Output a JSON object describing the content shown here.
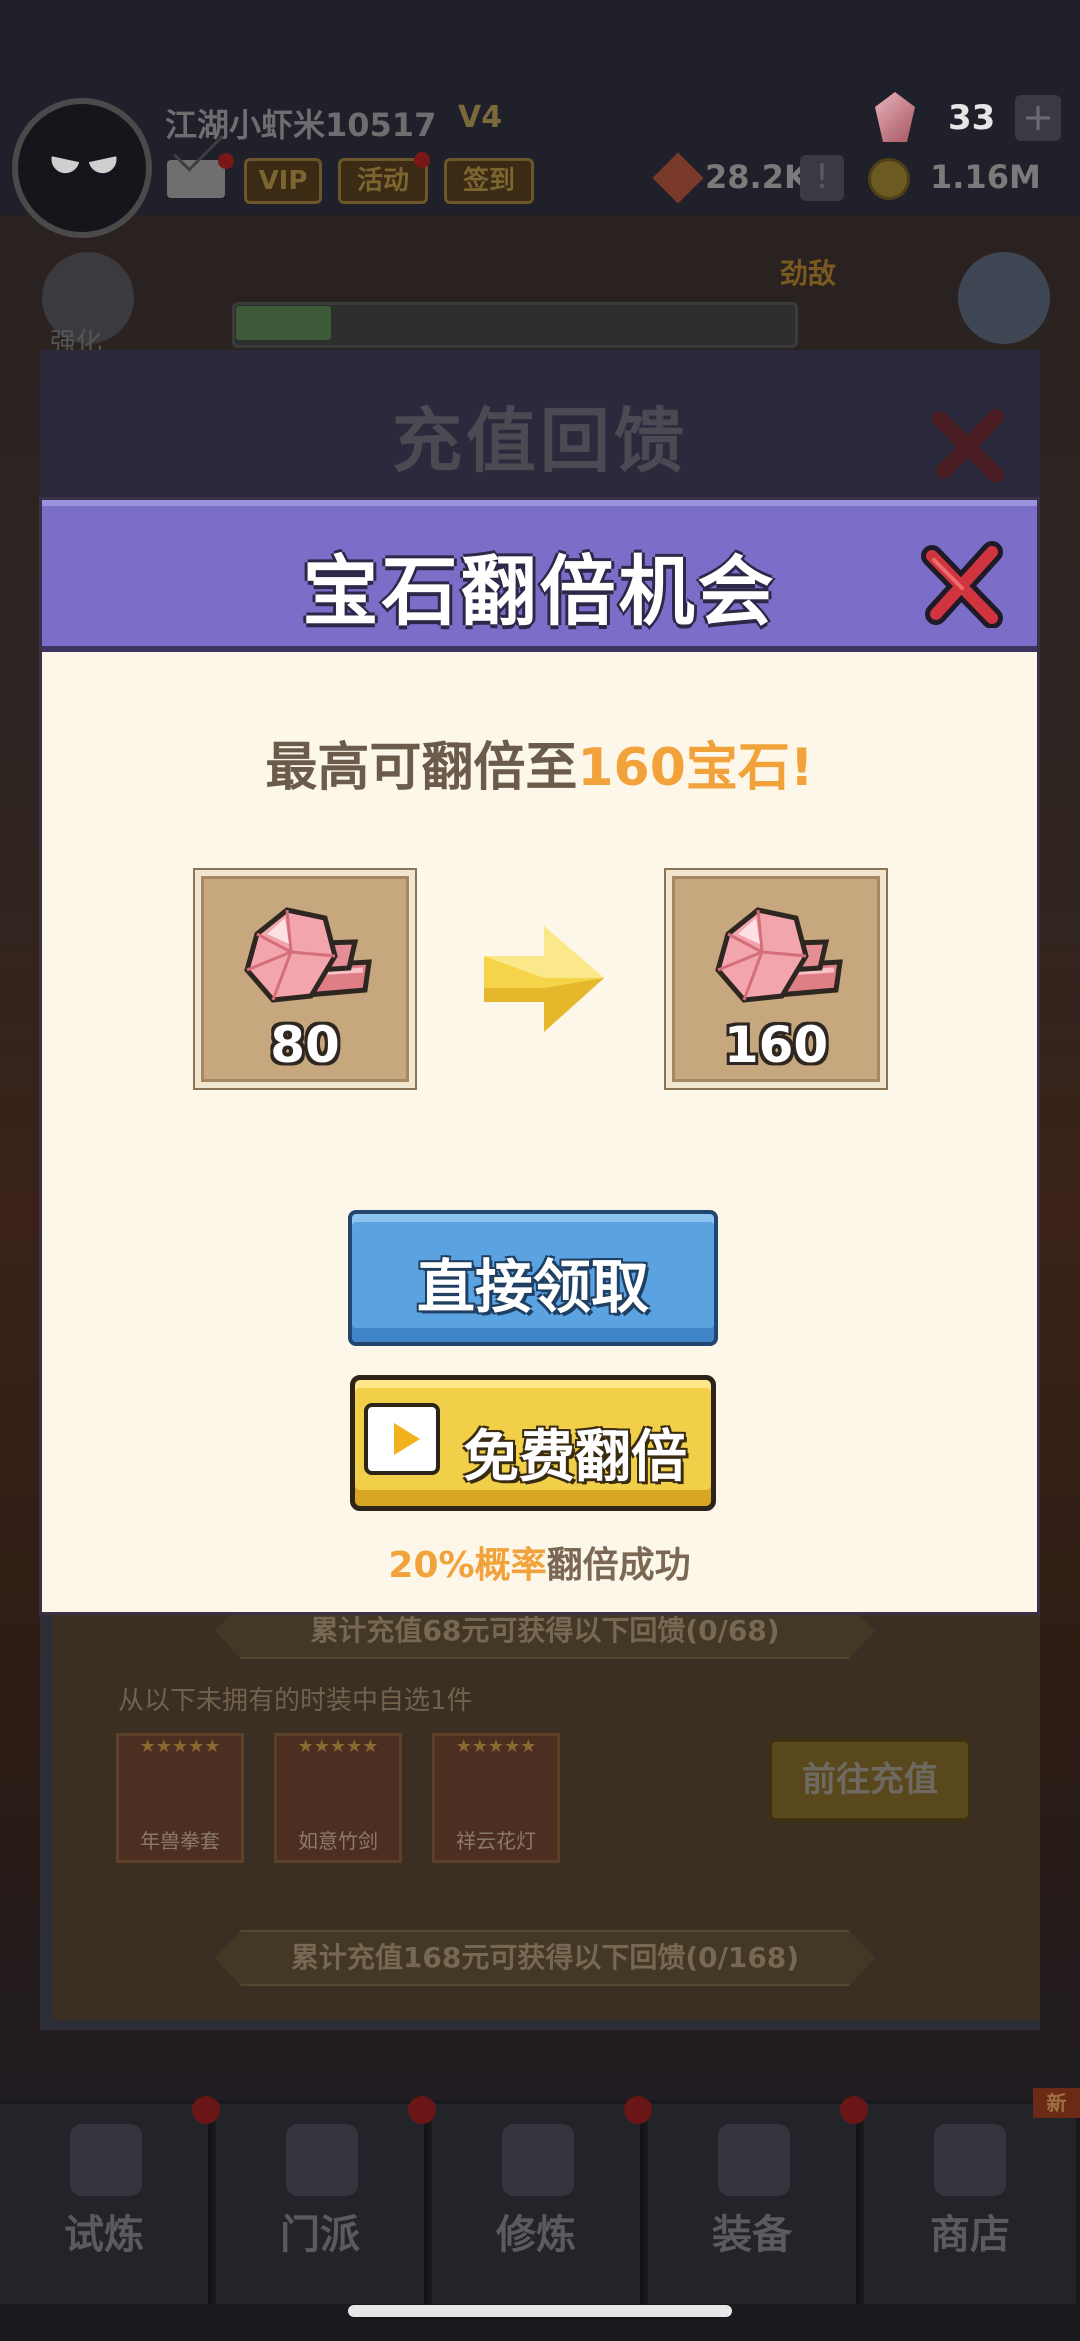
{
  "hud": {
    "player_name": "江湖小虾米10517",
    "player_level": "V4",
    "buttons": {
      "vip": "VIP",
      "event": "活动",
      "signin": "签到"
    },
    "gem_count": "33",
    "gem_plus": "+",
    "token_count": "28.2K",
    "token_plus": "!",
    "coin_count": "1.16M"
  },
  "scene": {
    "left_side_label": "强化",
    "enemy_label": "劲敌",
    "progress": 0.17
  },
  "back_dialog": {
    "title": "充值回馈",
    "tier1_text": "累计充值68元可获得以下回馈(0/68)",
    "hint": "从以下未拥有的时装中自选1件",
    "items": [
      {
        "name": "年兽拳套",
        "stars": "★★★★★"
      },
      {
        "name": "如意竹剑",
        "stars": "★★★★★"
      },
      {
        "name": "祥云花灯",
        "stars": "★★★★★"
      }
    ],
    "recharge_button": "前往充值",
    "tier2_text": "累计充值168元可获得以下回馈(0/168)"
  },
  "dialog": {
    "title": "宝石翻倍机会",
    "subtitle_prefix": "最高可翻倍至",
    "subtitle_highlight": "160宝石!",
    "from_amount": "80",
    "to_amount": "160",
    "claim_button": "直接领取",
    "double_button": "免费翻倍",
    "chance_highlight": "20%概率",
    "chance_suffix": "翻倍成功"
  },
  "nav": {
    "tabs": [
      "试炼",
      "门派",
      "修炼",
      "装备",
      "商店"
    ],
    "new_badge": "新"
  },
  "colors": {
    "header_purple": "#7a6ec8",
    "highlight_orange": "#f1a23a",
    "claim_blue": "#5aa2e0",
    "double_yellow": "#f2cf48"
  },
  "icons": [
    "gem-icon",
    "arrow-right-icon",
    "close-icon",
    "play-icon",
    "mail-icon",
    "coin-icon"
  ]
}
